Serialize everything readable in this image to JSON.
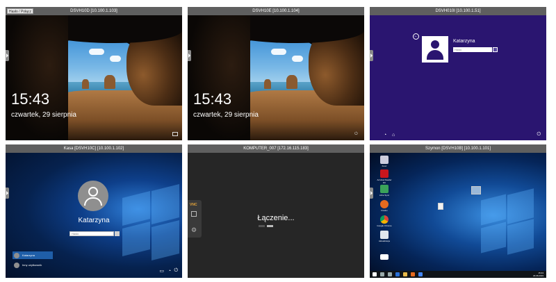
{
  "toolbar": {
    "home_label": "Hasło / Połącz"
  },
  "tiles": [
    {
      "title": "DSVH10D   [10.100.1.103]",
      "time": "15:43",
      "date": "czwartek, 29 sierpnia"
    },
    {
      "title": "DSVH10E   [10.100.1.104]",
      "time": "15:43",
      "date": "czwartek, 29 sierpnia"
    },
    {
      "title": "DSVH010I   [10.100.1.51]",
      "user": "Katarzyna",
      "password_placeholder": "Hasło"
    },
    {
      "title": "Kasa [DSVH10C]   [10.100.1.102]",
      "user": "Katarzyna",
      "password_placeholder": "Hasło",
      "users": [
        "Katarzyna",
        "Inny użytkownik"
      ]
    },
    {
      "title": "KOMPUTER_007   [172.16.115.183]",
      "status": "Łączenie...",
      "logo": "VNC"
    },
    {
      "title": "Szymon [DSVH10B]   [10.100.1.101]",
      "icons": [
        "Kosz",
        "Acrobat Reader DC",
        "Libre Sync",
        "Firefox",
        "Google Chrome",
        "Aktualizacja"
      ],
      "clock": "15:43",
      "clock_date": "29.08.2019"
    }
  ],
  "colors": {
    "titlebar": "#5f5f5f",
    "win8_purple": "#2a1570",
    "win10_blue": "#0e3f8a"
  }
}
